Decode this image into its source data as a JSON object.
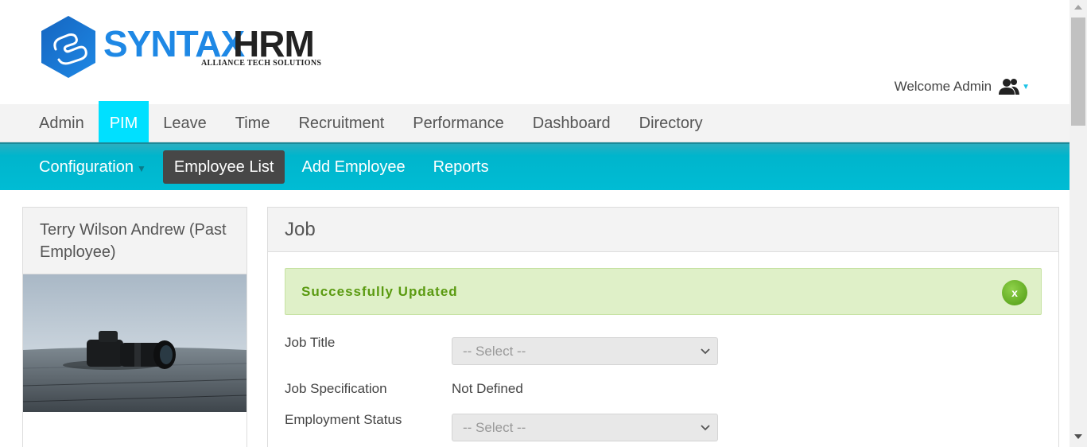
{
  "brand": {
    "logo_word_1": "SYNTAX",
    "logo_word_2": "HRM",
    "tagline": "ALLIANCE TECH SOLUTIONS"
  },
  "header": {
    "welcome": "Welcome Admin"
  },
  "main_nav": {
    "items": [
      "Admin",
      "PIM",
      "Leave",
      "Time",
      "Recruitment",
      "Performance",
      "Dashboard",
      "Directory"
    ],
    "active": "PIM"
  },
  "sub_nav": {
    "items": [
      "Configuration",
      "Employee List",
      "Add Employee",
      "Reports"
    ],
    "active": "Employee List"
  },
  "profile": {
    "name": "Terry Wilson Andrew (Past Employee)"
  },
  "job": {
    "title": "Job",
    "alert": "Successfully Updated",
    "alert_close": "x",
    "fields": {
      "job_title": {
        "label": "Job Title",
        "value": "-- Select --"
      },
      "job_specification": {
        "label": "Job Specification",
        "value": "Not Defined"
      },
      "employment_status": {
        "label": "Employment Status",
        "value": "-- Select --"
      }
    }
  },
  "colors": {
    "accent": "#00e0ff",
    "subnav": "#00bcd4",
    "active_subnav": "#474747",
    "success_bg": "#dff0c8",
    "success_text": "#5a9a10",
    "brand_blue": "#1e88e5"
  },
  "icons": {
    "welcome": "users-icon",
    "close": "close-icon",
    "select_chevron": "chevron-down-icon"
  }
}
